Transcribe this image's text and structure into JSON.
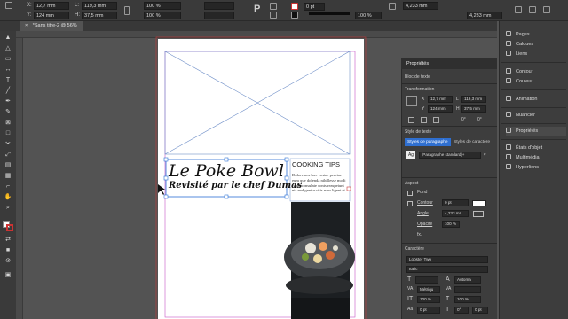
{
  "control_bar": {
    "x_label": "X:",
    "x_value": "12,7 mm",
    "y_label": "Y:",
    "y_value": "124 mm",
    "w_label": "L:",
    "w_value": "119,3 mm",
    "h_label": "H:",
    "h_value": "37,5 mm",
    "scale_x": "100 %",
    "scale_y": "100 %",
    "rotation_hint": "P",
    "stroke_weight": "0 pt",
    "opacity": "100 %",
    "ref_w": "4,233 mm",
    "ref_h": "4,233 mm"
  },
  "document_tab": {
    "label": "*Sans titre-2 @ 56%",
    "close": "×"
  },
  "page": {
    "headline": "Le Poke Bowl",
    "subheadline": "Revisité par le chef Dumas",
    "cooking_title": "COOKING TIPS",
    "cooking_body": "Dolore nos lore vostae pereiae eum que dolenda nihillesse modi rione consulate conts reaspeiunt nis endigentur sitis nam ligent et"
  },
  "properties": {
    "panel_title": "Propriétés",
    "section_text_frame": "Bloc de texte",
    "section_transform": "Transformation",
    "x_label": "X",
    "x_value": "12,7 mm",
    "y_label": "Y",
    "y_value": "124 mm",
    "w_label": "L",
    "w_value": "119,3 mm",
    "h_label": "H",
    "h_value": "37,5 mm",
    "rotation_value": "0°",
    "shear_value": "0°",
    "section_text_style": "Style de texte",
    "tab_paragraph": "Styles de paragraphe",
    "tab_character": "Styles de caractère",
    "paragraph_style": "[Paragraphe standard]+",
    "section_appearance": "Aspect",
    "fill_label": "Fond",
    "stroke_label": "Contour",
    "stroke_value": "0 pt",
    "corner_label": "Angle",
    "corner_value": "4,233 mr",
    "opacity_label": "Opacité",
    "opacity_value": "100 %",
    "fx_label": "fx.",
    "section_character": "Caractère",
    "font_name": "Lobster Two",
    "font_style": "Italic",
    "size_auto": "Automa",
    "kerning": "Métriqu",
    "pct_1": "100 %",
    "pct_2": "100 %",
    "pt_zero_1": "0 pt",
    "pt_zero_2": "0 pt",
    "deg_zero": "0°"
  },
  "dock": {
    "items": [
      {
        "label": "Pages",
        "icon": "pages-icon"
      },
      {
        "label": "Calques",
        "icon": "layers-icon"
      },
      {
        "label": "Liens",
        "icon": "links-icon"
      },
      {
        "label": "Contour",
        "icon": "stroke-icon"
      },
      {
        "label": "Couleur",
        "icon": "color-icon"
      },
      {
        "label": "Animation",
        "icon": "animation-icon"
      },
      {
        "label": "Nuancier",
        "icon": "swatches-icon"
      },
      {
        "label": "Propriétés",
        "icon": "properties-icon"
      },
      {
        "label": "États d'objet",
        "icon": "object-states-icon"
      },
      {
        "label": "Multimédia",
        "icon": "media-icon"
      },
      {
        "label": "Hyperliens",
        "icon": "hyperlinks-icon"
      }
    ]
  },
  "colors": {
    "selection": "#2a6fd6",
    "margin_guide": "#d04fd0",
    "bleed_guide": "#cc3333"
  }
}
